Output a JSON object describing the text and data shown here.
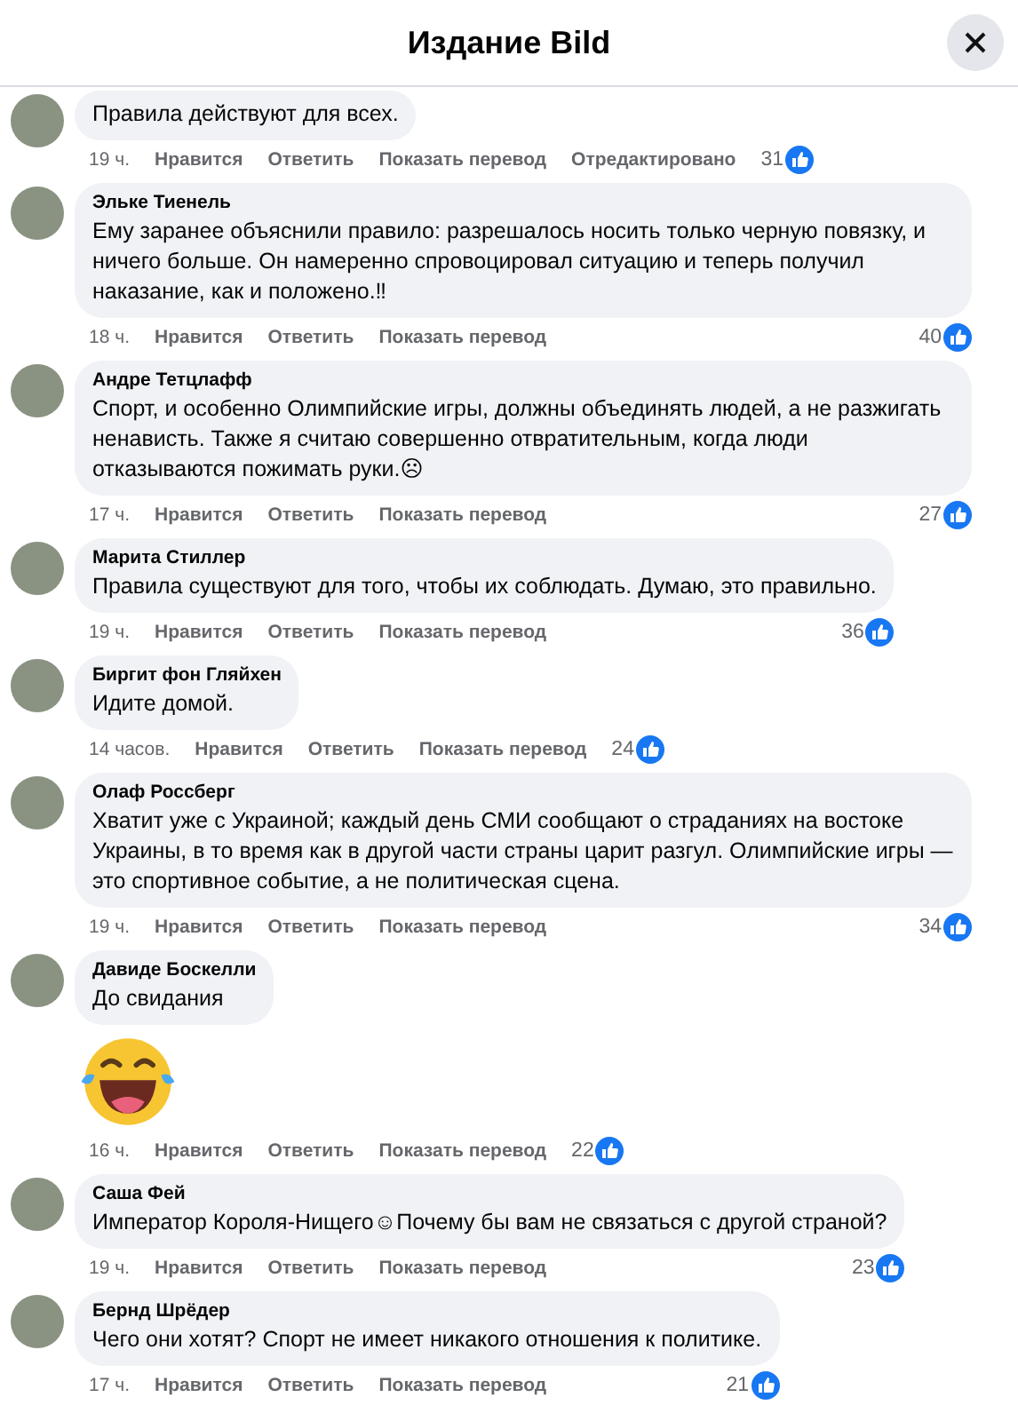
{
  "header": {
    "title": "Издание Bild"
  },
  "comments": [
    {
      "text": "Правила действуют для всех.",
      "time": "19 ч.",
      "actions": [
        "Нравится",
        "Ответить",
        "Показать перевод",
        "Отредактировано"
      ],
      "likes": "31"
    },
    {
      "author": "Эльке Тиенель",
      "text": "Ему заранее объяснили правило: разрешалось носить только черную повязку, и ничего больше. Он намеренно спровоцировал ситуацию и теперь получил наказание, как и положено.‼",
      "time": "18 ч.",
      "actions": [
        "Нравится",
        "Ответить",
        "Показать перевод"
      ],
      "likes": "40"
    },
    {
      "author": "Андре Тетцлафф",
      "text": "Спорт, и особенно Олимпийские игры, должны объединять людей, а не разжигать ненависть. Также я считаю совершенно отвратительным, когда люди отказываются пожимать руки.☹",
      "time": "17 ч.",
      "actions": [
        "Нравится",
        "Ответить",
        "Показать перевод"
      ],
      "likes": "27"
    },
    {
      "author": "Марита Стиллер",
      "text": "Правила существуют для того, чтобы их соблюдать. Думаю, это правильно.",
      "time": "19 ч.",
      "actions": [
        "Нравится",
        "Ответить",
        "Показать перевод"
      ],
      "likes": "36"
    },
    {
      "author": "Биргит фон Гляйхен",
      "text": "Идите домой.",
      "time": "14 часов.",
      "actions": [
        "Нравится",
        "Ответить",
        "Показать перевод"
      ],
      "likes": "24"
    },
    {
      "author": "Олаф Россберг",
      "text": "Хватит уже с Украиной; каждый день СМИ сообщают о страданиях на востоке Украины, в то время как в другой части страны царит разгул. Олимпийские игры — это спортивное событие, а не политическая сцена.",
      "time": "19 ч.",
      "actions": [
        "Нравится",
        "Ответить",
        "Показать перевод"
      ],
      "likes": "34"
    },
    {
      "author": "Давиде Боскелли",
      "text": "До свидания",
      "sticker": true,
      "time": "16 ч.",
      "actions": [
        "Нравится",
        "Ответить",
        "Показать перевод"
      ],
      "likes": "22"
    },
    {
      "author": "Саша Фей",
      "text": "Император Короля-Нищего☺Почему бы вам не связаться с другой страной?",
      "time": "19 ч.",
      "actions": [
        "Нравится",
        "Ответить",
        "Показать перевод"
      ],
      "likes": "23"
    },
    {
      "author": "Бернд Шрёдер",
      "text": "Чего они хотят? Спорт не имеет никакого отношения к политике.",
      "time": "17 ч.",
      "actions": [
        "Нравится",
        "Ответить",
        "Показать перевод"
      ],
      "likes": "21"
    }
  ]
}
